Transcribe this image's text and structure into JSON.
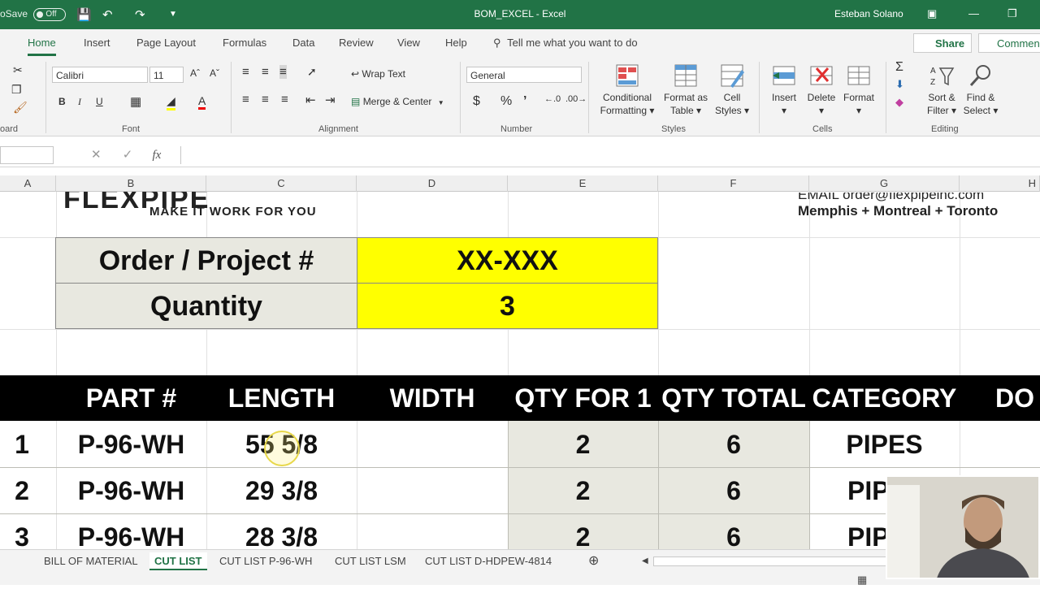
{
  "titlebar": {
    "autosave_label": "oSave",
    "autosave_state": "Off",
    "doc_title": "BOM_EXCEL  -  Excel",
    "user": "Esteban Solano"
  },
  "ribbon_tabs": [
    "Home",
    "Insert",
    "Page Layout",
    "Formulas",
    "Data",
    "Review",
    "View",
    "Help"
  ],
  "tell_me": "Tell me what you want to do",
  "share_label": "Share",
  "comments_label": "Commen",
  "ribbon": {
    "font_name": "Calibri",
    "font_size": "11",
    "wrap_text": "Wrap Text",
    "merge_center": "Merge & Center",
    "number_format": "General",
    "conditional_formatting": [
      "Conditional",
      "Formatting"
    ],
    "format_as_table": [
      "Format as",
      "Table"
    ],
    "cell_styles": [
      "Cell",
      "Styles"
    ],
    "insert": "Insert",
    "delete": "Delete",
    "format": "Format",
    "sort_filter": [
      "Sort &",
      "Filter"
    ],
    "find_select": [
      "Find &",
      "Select"
    ],
    "groups": [
      "oard",
      "Font",
      "Alignment",
      "Number",
      "Styles",
      "Cells",
      "Editing"
    ]
  },
  "formula_bar": {
    "fx": "fx"
  },
  "columns": [
    "A",
    "B",
    "C",
    "D",
    "E",
    "F",
    "G",
    "H"
  ],
  "sheet": {
    "logo_tagline": "MAKE IT WORK FOR YOU",
    "logo_name": "FLEXPIPE",
    "contact_email": "EMAIL order@flexpipeinc.com",
    "contact_cities": "Memphis + Montreal + Toronto",
    "order_label": "Order / Project #",
    "order_value": "XX-XXX",
    "quantity_label": "Quantity",
    "quantity_value": "3",
    "headers": [
      "PART #",
      "LENGTH",
      "WIDTH",
      "QTY FOR 1",
      "QTY TOTAL",
      "CATEGORY",
      "DO"
    ],
    "rows": [
      {
        "num": "1",
        "part": "P-96-WH",
        "length": "55 5/8",
        "width": "",
        "qty1": "2",
        "qtytotal": "6",
        "category": "PIPES"
      },
      {
        "num": "2",
        "part": "P-96-WH",
        "length": "29 3/8",
        "width": "",
        "qty1": "2",
        "qtytotal": "6",
        "category": "PIP"
      },
      {
        "num": "3",
        "part": "P-96-WH",
        "length": "28 3/8",
        "width": "",
        "qty1": "2",
        "qtytotal": "6",
        "category": "PIP"
      }
    ]
  },
  "sheet_tabs": [
    "BILL OF MATERIAL",
    "CUT LIST",
    "CUT LIST P-96-WH",
    "CUT LIST LSM",
    "CUT LIST D-HDPEW-4814"
  ],
  "active_sheet_tab": "CUT LIST",
  "colors": {
    "excel_green": "#217346",
    "highlight_yellow": "#ffff00",
    "label_shade": "#e8e8e0"
  }
}
